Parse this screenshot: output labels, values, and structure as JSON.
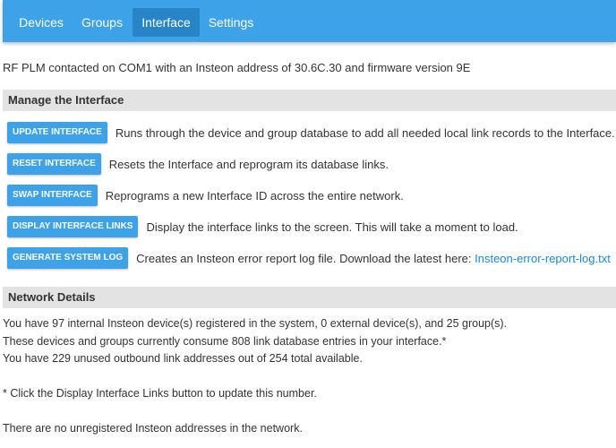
{
  "nav": {
    "items": [
      {
        "label": "Devices"
      },
      {
        "label": "Groups"
      },
      {
        "label": "Interface"
      },
      {
        "label": "Settings"
      }
    ],
    "active": "Interface"
  },
  "status_line": "RF PLM contacted on COM1 with an Insteon address of 30.6C.30 and firmware version 9E",
  "manage": {
    "header": "Manage the Interface",
    "actions": [
      {
        "button": "UPDATE INTERFACE",
        "description": "Runs through the device and group database to add all needed local link records to the Interface."
      },
      {
        "button": "RESET INTERFACE",
        "description": "Resets the Interface and reprogram its database links."
      },
      {
        "button": "SWAP INTERFACE",
        "description": "Reprograms a new Interface ID across the entire network."
      },
      {
        "button": "DISPLAY INTERFACE LINKS",
        "description": "Display the interface links to the screen. This will take a moment to load."
      },
      {
        "button": "GENERATE SYSTEM LOG",
        "description": "Creates an Insteon error report log file. Download the latest here:",
        "link": "Insteon-error-report-log.txt"
      }
    ]
  },
  "network": {
    "header": "Network Details",
    "line1": "You have 97 internal Insteon device(s) registered in the system, 0 external device(s), and 25 group(s).",
    "line2": "These devices and groups currently consume 808 link database entries in your interface.*",
    "line3": "You have 229 unused outbound link addresses out of 254 total available.",
    "footnote": "* Click the Display Interface Links button to update this number.",
    "unregistered": "There are no unregistered Insteon addresses in the network."
  }
}
